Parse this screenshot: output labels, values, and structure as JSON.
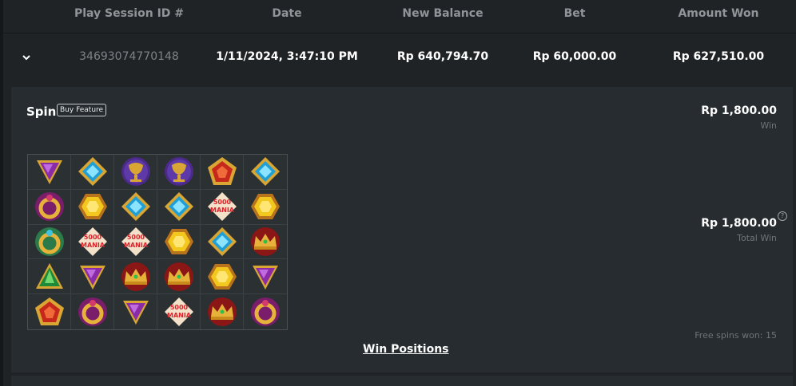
{
  "table": {
    "headers": [
      "Play Session ID #",
      "Date",
      "New Balance",
      "Bet",
      "Amount Won"
    ]
  },
  "session": {
    "id": "34693074770148",
    "date": "1/11/2024, 3:47:10 PM",
    "new_balance": "Rp 640,794.70",
    "bet": "Rp 60,000.00",
    "amount_won": "Rp 627,510.00"
  },
  "spin": {
    "title": "Spin",
    "badge": "Buy Feature",
    "win_amount": "Rp 1,800.00",
    "win_label": "Win",
    "total_win_amount": "Rp 1,800.00",
    "total_win_label": "Total Win",
    "help_glyph": "?",
    "free_spins": "Free spins won: 15",
    "win_positions": "Win Positions"
  },
  "grid_labels": {
    "mania_top": "5000",
    "mania_bottom": "MANIA"
  },
  "grid": [
    [
      "purple-gem-icon",
      "blue-diamond-icon",
      "gold-chalice-icon",
      "gold-chalice-icon",
      "red-pentagon-gem-icon",
      "blue-diamond-icon"
    ],
    [
      "gold-ring-icon",
      "yellow-hexagon-gem-icon",
      "blue-diamond-icon",
      "blue-diamond-icon",
      "mania-bonus-icon",
      "yellow-hexagon-gem-icon"
    ],
    [
      "green-ring-icon",
      "mania-bonus-icon",
      "mania-bonus-icon",
      "yellow-hexagon-gem-icon",
      "blue-diamond-icon",
      "crown-icon"
    ],
    [
      "green-gem-icon",
      "purple-gem-icon",
      "crown-icon",
      "crown-icon",
      "yellow-hexagon-gem-icon",
      "purple-gem-icon"
    ],
    [
      "red-pentagon-gem-icon",
      "gold-ring-icon",
      "purple-gem-icon",
      "mania-bonus-icon",
      "crown-icon",
      "gold-ring-icon"
    ]
  ],
  "colors": {
    "background": "#1f2326",
    "panel": "#262c2f",
    "header_text": "#8f9598"
  }
}
